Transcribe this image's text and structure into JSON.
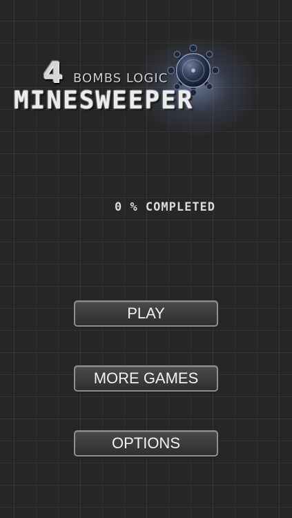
{
  "logo": {
    "number": "4",
    "subtitle": "BOMBS LOGIC",
    "title": "MINESWEEPER"
  },
  "progress": {
    "value_percent": 0,
    "text": "0 % COMPLETED"
  },
  "menu": {
    "play_label": "PLAY",
    "more_games_label": "MORE GAMES",
    "options_label": "OPTIONS"
  },
  "icons": {
    "mine": "mine-bomb-icon"
  },
  "colors": {
    "background": "#262626",
    "grid": "#363636",
    "button_border": "#909090",
    "glow": "#96afe1"
  }
}
